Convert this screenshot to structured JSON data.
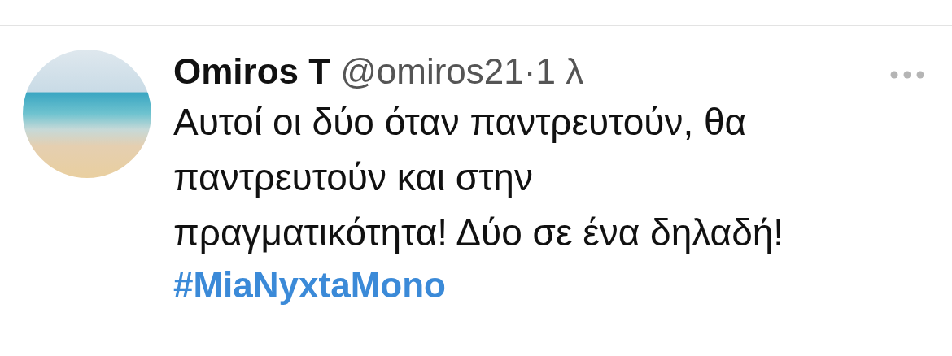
{
  "tweet": {
    "display_name": "Omiros T",
    "handle": "@omiros21",
    "separator": "·",
    "time": "1 λ",
    "text": "Αυτοί οι δύο όταν παντρευτούν, θα παντρευτούν και στην πραγματικότητα! Δύο σε ένα δηλαδή!",
    "hashtag": "#MiaNyxtaMono"
  }
}
